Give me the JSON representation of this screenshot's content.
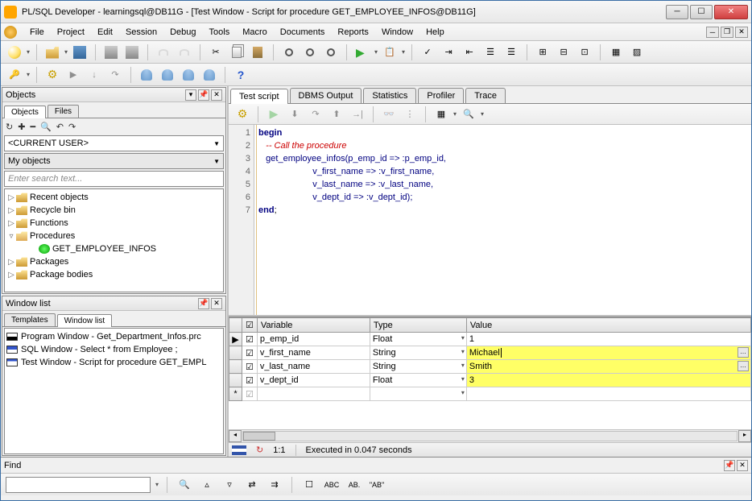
{
  "window": {
    "title": "PL/SQL Developer - learningsql@DB11G - [Test Window - Script for procedure GET_EMPLOYEE_INFOS@DB11G]"
  },
  "menu": {
    "items": [
      "File",
      "Project",
      "Edit",
      "Session",
      "Debug",
      "Tools",
      "Macro",
      "Documents",
      "Reports",
      "Window",
      "Help"
    ]
  },
  "objects_panel": {
    "title": "Objects",
    "subtabs": [
      "Objects",
      "Files"
    ],
    "current_user": "<CURRENT USER>",
    "my_objects": "My objects",
    "search_placeholder": "Enter search text...",
    "tree": [
      {
        "label": "Recent objects",
        "icon": "folder",
        "exp": "▷"
      },
      {
        "label": "Recycle bin",
        "icon": "folder",
        "exp": "▷"
      },
      {
        "label": "Functions",
        "icon": "folder",
        "exp": "▷"
      },
      {
        "label": "Procedures",
        "icon": "folder-open",
        "exp": "▿",
        "children": [
          {
            "label": "GET_EMPLOYEE_INFOS",
            "icon": "proc"
          }
        ]
      },
      {
        "label": "Packages",
        "icon": "folder",
        "exp": "▷"
      },
      {
        "label": "Package bodies",
        "icon": "folder",
        "exp": "▷"
      }
    ]
  },
  "window_list": {
    "title": "Window list",
    "subtabs": [
      "Templates",
      "Window list"
    ],
    "items": [
      {
        "icon": "pw",
        "label": "Program Window - Get_Department_Infos.prc"
      },
      {
        "icon": "sq",
        "label": "SQL Window - Select * from Employee ;"
      },
      {
        "icon": "tw",
        "label": "Test Window - Script for procedure GET_EMPL"
      }
    ]
  },
  "main_tabs": [
    "Test script",
    "DBMS Output",
    "Statistics",
    "Profiler",
    "Trace"
  ],
  "code": {
    "lines": [
      "1",
      "2",
      "3",
      "4",
      "5",
      "6",
      "7"
    ],
    "l1_kw": "begin",
    "l2_cm": "   -- Call the procedure",
    "l3a": "   get_employee_infos(p_emp_id => :p_emp_id,",
    "l4": "                      v_first_name => :v_first_name,",
    "l5": "                      v_last_name => :v_last_name,",
    "l6": "                      v_dept_id => :v_dept_id);",
    "l7_kw": "end",
    "l7_sc": ";"
  },
  "vars": {
    "headers": {
      "chk": "",
      "var": "Variable",
      "type": "Type",
      "val": "Value"
    },
    "rows": [
      {
        "ind": "▶",
        "chk": true,
        "var": "p_emp_id",
        "type": "Float",
        "val": "1",
        "hl": false
      },
      {
        "ind": "",
        "chk": true,
        "var": "v_first_name",
        "type": "String",
        "val": "Michael",
        "hl": true,
        "ell": true
      },
      {
        "ind": "",
        "chk": true,
        "var": "v_last_name",
        "type": "String",
        "val": "Smith",
        "hl": true,
        "ell": true
      },
      {
        "ind": "",
        "chk": true,
        "var": "v_dept_id",
        "type": "Float",
        "val": "3",
        "hl": true
      },
      {
        "ind": "*",
        "chk": false,
        "var": "",
        "type": "",
        "val": "",
        "hl": false
      }
    ]
  },
  "status": {
    "pos": "1:1",
    "msg": "Executed in 0.047 seconds"
  },
  "find": {
    "label": "Find",
    "abc": "ABC",
    "abc2": "AB.",
    "ab": "\"AB\""
  }
}
